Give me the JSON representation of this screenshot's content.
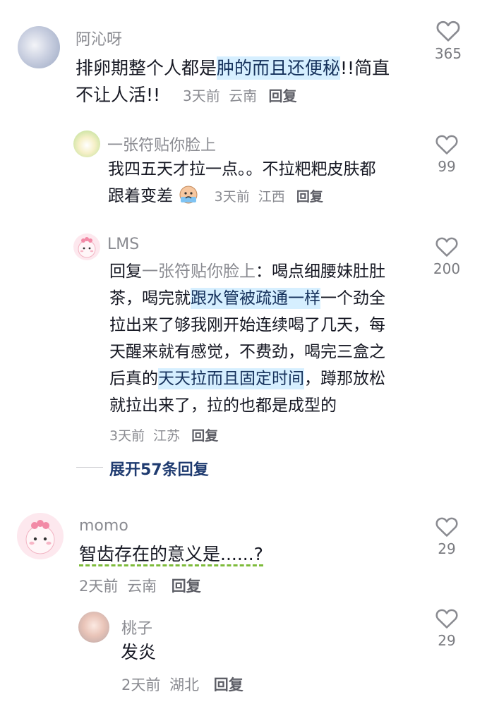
{
  "comments": [
    {
      "user": "阿沁呀",
      "text_parts": [
        "排卵期整个人都是",
        "肿的而且还便秘",
        "!!简直"
      ],
      "text_line2": "不让人活!!",
      "time": "3天前",
      "location": "云南",
      "reply": "回复",
      "likes": "365"
    },
    {
      "user": "一张符贴你脸上",
      "text_line1": "我四五天才拉一点。。不拉粑粑皮肤都",
      "text_line2": "跟着变差",
      "time": "3天前",
      "location": "江西",
      "reply": "回复",
      "likes": "99"
    },
    {
      "user": "LMS",
      "reply_label": "回复",
      "reply_target": "一张符贴你脸上",
      "line1_rest": "：喝点细腰妹肚肚",
      "line2_a": "茶，喝完就",
      "line2_hl": "跟水管被疏通一样",
      "line2_b": "一个劲全",
      "line3": "拉出来了够我刚开始连续喝了几天，每",
      "line4": "天醒来就有感觉，不费劲，喝完三盒之",
      "line5_a": "后真的",
      "line5_hl": "天天拉而且固定时间",
      "line5_b": "，蹲那放松",
      "line6": "就拉出来了，拉的也都是成型的",
      "time": "3天前",
      "location": "江苏",
      "reply": "回复",
      "likes": "200"
    },
    {
      "user": "momo",
      "text": "智齿存在的意义是......?",
      "time": "2天前",
      "location": "云南",
      "reply": "回复",
      "likes": "29"
    },
    {
      "user": "桃子",
      "text": "发炎",
      "time": "2天前",
      "location": "湖北",
      "reply": "回复",
      "likes": "29"
    }
  ],
  "expand_replies": "展开57条回复",
  "icons": {
    "like": "heart-outline-icon"
  }
}
